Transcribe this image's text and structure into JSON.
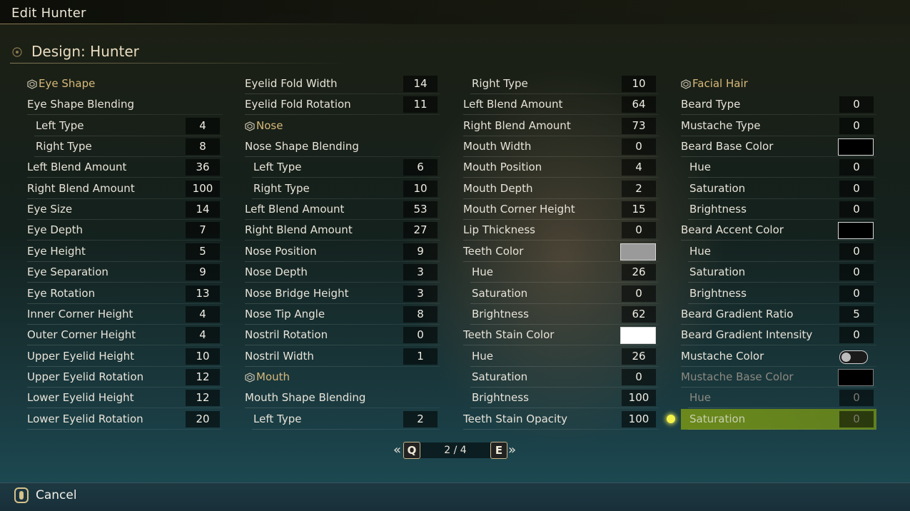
{
  "window": {
    "title": "Edit Hunter"
  },
  "design": {
    "title": "Design: Hunter"
  },
  "columns": [
    [
      {
        "type": "header",
        "label": "Eye Shape"
      },
      {
        "type": "label",
        "label": "Eye Shape Blending"
      },
      {
        "type": "value",
        "label": "Left Type",
        "value": "4",
        "sub": true
      },
      {
        "type": "value",
        "label": "Right Type",
        "value": "8",
        "sub": true
      },
      {
        "type": "value",
        "label": "Left Blend Amount",
        "value": "36"
      },
      {
        "type": "value",
        "label": "Right Blend Amount",
        "value": "100"
      },
      {
        "type": "value",
        "label": "Eye Size",
        "value": "14"
      },
      {
        "type": "value",
        "label": "Eye Depth",
        "value": "7"
      },
      {
        "type": "value",
        "label": "Eye Height",
        "value": "5"
      },
      {
        "type": "value",
        "label": "Eye Separation",
        "value": "9"
      },
      {
        "type": "value",
        "label": "Eye Rotation",
        "value": "13"
      },
      {
        "type": "value",
        "label": "Inner Corner Height",
        "value": "4"
      },
      {
        "type": "value",
        "label": "Outer Corner Height",
        "value": "4"
      },
      {
        "type": "value",
        "label": "Upper Eyelid Height",
        "value": "10"
      },
      {
        "type": "value",
        "label": "Upper Eyelid Rotation",
        "value": "12"
      },
      {
        "type": "value",
        "label": "Lower Eyelid Height",
        "value": "12"
      },
      {
        "type": "value",
        "label": "Lower Eyelid Rotation",
        "value": "20"
      }
    ],
    [
      {
        "type": "value",
        "label": "Eyelid Fold Width",
        "value": "14"
      },
      {
        "type": "value",
        "label": "Eyelid Fold Rotation",
        "value": "11"
      },
      {
        "type": "header",
        "label": "Nose"
      },
      {
        "type": "label",
        "label": "Nose Shape Blending"
      },
      {
        "type": "value",
        "label": "Left Type",
        "value": "6",
        "sub": true
      },
      {
        "type": "value",
        "label": "Right Type",
        "value": "10",
        "sub": true
      },
      {
        "type": "value",
        "label": "Left Blend Amount",
        "value": "53"
      },
      {
        "type": "value",
        "label": "Right Blend Amount",
        "value": "27"
      },
      {
        "type": "value",
        "label": "Nose Position",
        "value": "9"
      },
      {
        "type": "value",
        "label": "Nose Depth",
        "value": "3"
      },
      {
        "type": "value",
        "label": "Nose Bridge Height",
        "value": "3"
      },
      {
        "type": "value",
        "label": "Nose Tip Angle",
        "value": "8"
      },
      {
        "type": "value",
        "label": "Nostril Rotation",
        "value": "0"
      },
      {
        "type": "value",
        "label": "Nostril Width",
        "value": "1"
      },
      {
        "type": "header",
        "label": "Mouth"
      },
      {
        "type": "label",
        "label": "Mouth Shape Blending"
      },
      {
        "type": "value",
        "label": "Left Type",
        "value": "2",
        "sub": true
      }
    ],
    [
      {
        "type": "value",
        "label": "Right Type",
        "value": "10",
        "sub": true
      },
      {
        "type": "value",
        "label": "Left Blend Amount",
        "value": "64"
      },
      {
        "type": "value",
        "label": "Right Blend Amount",
        "value": "73"
      },
      {
        "type": "value",
        "label": "Mouth Width",
        "value": "0"
      },
      {
        "type": "value",
        "label": "Mouth Position",
        "value": "4"
      },
      {
        "type": "value",
        "label": "Mouth Depth",
        "value": "2"
      },
      {
        "type": "value",
        "label": "Mouth Corner Height",
        "value": "15"
      },
      {
        "type": "value",
        "label": "Lip Thickness",
        "value": "0"
      },
      {
        "type": "color",
        "label": "Teeth Color",
        "color": "#9a9a9a"
      },
      {
        "type": "value",
        "label": "Hue",
        "value": "26",
        "sub": true
      },
      {
        "type": "value",
        "label": "Saturation",
        "value": "0",
        "sub": true
      },
      {
        "type": "value",
        "label": "Brightness",
        "value": "62",
        "sub": true
      },
      {
        "type": "color",
        "label": "Teeth Stain Color",
        "color": "#ffffff"
      },
      {
        "type": "value",
        "label": "Hue",
        "value": "26",
        "sub": true
      },
      {
        "type": "value",
        "label": "Saturation",
        "value": "0",
        "sub": true
      },
      {
        "type": "value",
        "label": "Brightness",
        "value": "100",
        "sub": true
      },
      {
        "type": "value",
        "label": "Teeth Stain Opacity",
        "value": "100"
      }
    ],
    [
      {
        "type": "header",
        "label": "Facial Hair"
      },
      {
        "type": "value",
        "label": "Beard Type",
        "value": "0"
      },
      {
        "type": "value",
        "label": "Mustache Type",
        "value": "0"
      },
      {
        "type": "color",
        "label": "Beard Base Color",
        "color": "#000000"
      },
      {
        "type": "value",
        "label": "Hue",
        "value": "0",
        "sub": true
      },
      {
        "type": "value",
        "label": "Saturation",
        "value": "0",
        "sub": true
      },
      {
        "type": "value",
        "label": "Brightness",
        "value": "0",
        "sub": true
      },
      {
        "type": "color",
        "label": "Beard Accent Color",
        "color": "#000000"
      },
      {
        "type": "value",
        "label": "Hue",
        "value": "0",
        "sub": true
      },
      {
        "type": "value",
        "label": "Saturation",
        "value": "0",
        "sub": true
      },
      {
        "type": "value",
        "label": "Brightness",
        "value": "0",
        "sub": true
      },
      {
        "type": "value",
        "label": "Beard Gradient Ratio",
        "value": "5"
      },
      {
        "type": "value",
        "label": "Beard Gradient Intensity",
        "value": "0"
      },
      {
        "type": "toggle",
        "label": "Mustache Color",
        "on": false
      },
      {
        "type": "color",
        "label": "Mustache Base Color",
        "color": "#000000",
        "dim": true
      },
      {
        "type": "value",
        "label": "Hue",
        "value": "0",
        "sub": true,
        "dim": true
      },
      {
        "type": "value",
        "label": "Saturation",
        "value": "0",
        "sub": true,
        "dim": true,
        "selected": true
      }
    ]
  ],
  "pager": {
    "prev_key": "Q",
    "next_key": "E",
    "page": "2 / 4"
  },
  "footer": {
    "cancel_label": "Cancel"
  },
  "colors": {
    "accent": "#d8b97a",
    "selection": "#7a9614",
    "marker": "#f4f24a"
  }
}
